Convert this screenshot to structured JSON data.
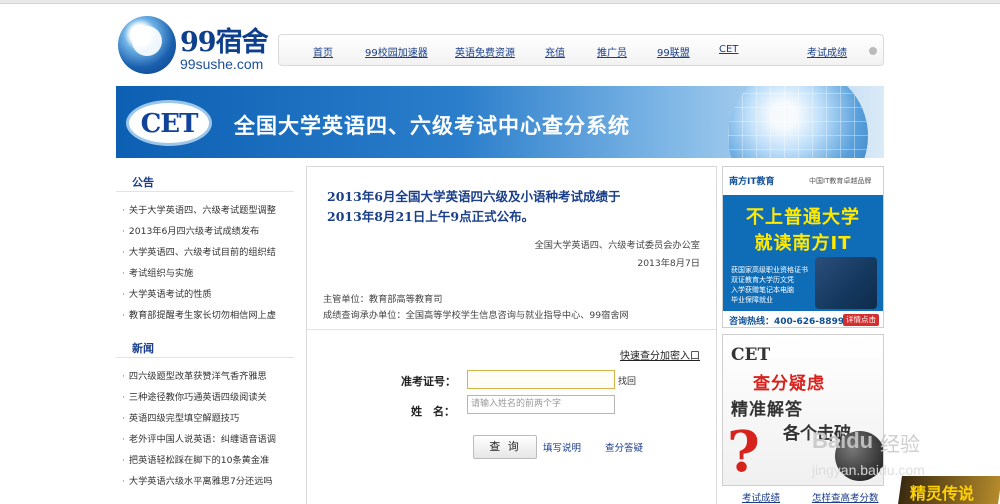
{
  "logo": {
    "brand": "99宿舍",
    "domain": "99sushe.com"
  },
  "nav": {
    "items": [
      "首页",
      "99校园加速器",
      "英语免费资源",
      "充值",
      "推广员",
      "99联盟",
      "CET"
    ],
    "right": "考试成绩"
  },
  "banner": {
    "badge": "CET",
    "title": "全国大学英语四、六级考试中心查分系统"
  },
  "announcements": {
    "title": "公告",
    "items": [
      "关于大学英语四、六级考试题型调整",
      "2013年6月四六级考试成绩发布",
      "大学英语四、六级考试目前的组织结",
      "考试组织与实施",
      "大学英语考试的性质",
      "教育部提醒考生家长切勿相信网上虚"
    ]
  },
  "news": {
    "title": "新闻",
    "items": [
      "四六级题型改革获赞洋气香齐雅思",
      "三种途径教你巧通英语四级阅读关",
      "英语四级完型填空解题技巧",
      "老外评中国人说英语：纠缠语音语调",
      "把英语轻松踩在脚下的10条黄金准",
      "大学英语六级水平离雅思7分还远吗"
    ]
  },
  "notice": {
    "line1": "2013年6月全国大学英语四六级及小语种考试成绩于",
    "line2": "2013年8月21日上午9点正式公布。",
    "signature": "全国大学英语四、六级考试委员会办公室",
    "date": "2013年8月7日",
    "supervisor": "主管单位：教育部高等教育司",
    "organizer": "成绩查询承办单位：全国高等学校学生信息咨询与就业指导中心、99宿舍网"
  },
  "form": {
    "quick_link": "快速查分加密入口",
    "ticket_label": "准考证号：",
    "ticket_value": "",
    "retrieve": "找回",
    "name_label": "姓　名：",
    "name_placeholder": "请输入姓名的前两个字",
    "submit": "查 询",
    "help": "填写说明",
    "faq": "查分答疑"
  },
  "ad1": {
    "logo": "南方IT教育",
    "tagline": "中国IT教育卓越品牌",
    "headline1": "不上普通大学",
    "headline2": "就读南方IT",
    "bullets": [
      "获国家高级职业资格证书",
      "双证教育大学历文凭",
      "入学获赠笔记本电脑",
      "毕业保障就业"
    ],
    "phone": "咨询热线：400-626-8899",
    "detail": "详情点击"
  },
  "ad2": {
    "cet": "CET",
    "line1": "查分疑虑",
    "line2": "精准解答",
    "line3": "各个击破"
  },
  "bottom_links": [
    "考试成绩",
    "怎样查高考分数"
  ],
  "watermark": {
    "brand": "Baidu",
    "label": "经验",
    "url": "jingyan.baidu.com"
  },
  "game_logo": "精灵传说"
}
